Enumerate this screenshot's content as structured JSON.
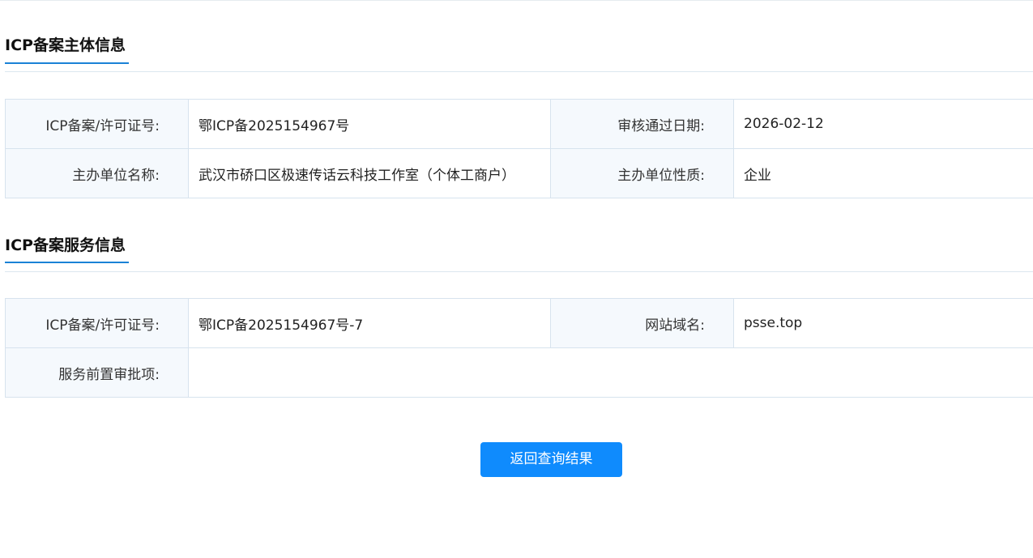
{
  "subject_section": {
    "title": "ICP备案主体信息",
    "rows": [
      {
        "label1": "ICP备案/许可证号:",
        "value1": "鄂ICP备2025154967号",
        "label2": "审核通过日期:",
        "value2": "2026-02-12"
      },
      {
        "label1": "主办单位名称:",
        "value1": "武汉市硚口区极速传话云科技工作室（个体工商户）",
        "label2": "主办单位性质:",
        "value2": "企业"
      }
    ]
  },
  "service_section": {
    "title": "ICP备案服务信息",
    "row1": {
      "label1": "ICP备案/许可证号:",
      "value1": "鄂ICP备2025154967号-7",
      "label2": "网站域名:",
      "value2": "psse.top"
    },
    "row2": {
      "label1": "服务前置审批项:",
      "value1": ""
    }
  },
  "actions": {
    "back_label": "返回查询结果"
  },
  "colors": {
    "accent": "#1a82d6",
    "button": "#0f8bfd",
    "label_bg": "#f5f9fd",
    "border": "#d7e3ee"
  }
}
